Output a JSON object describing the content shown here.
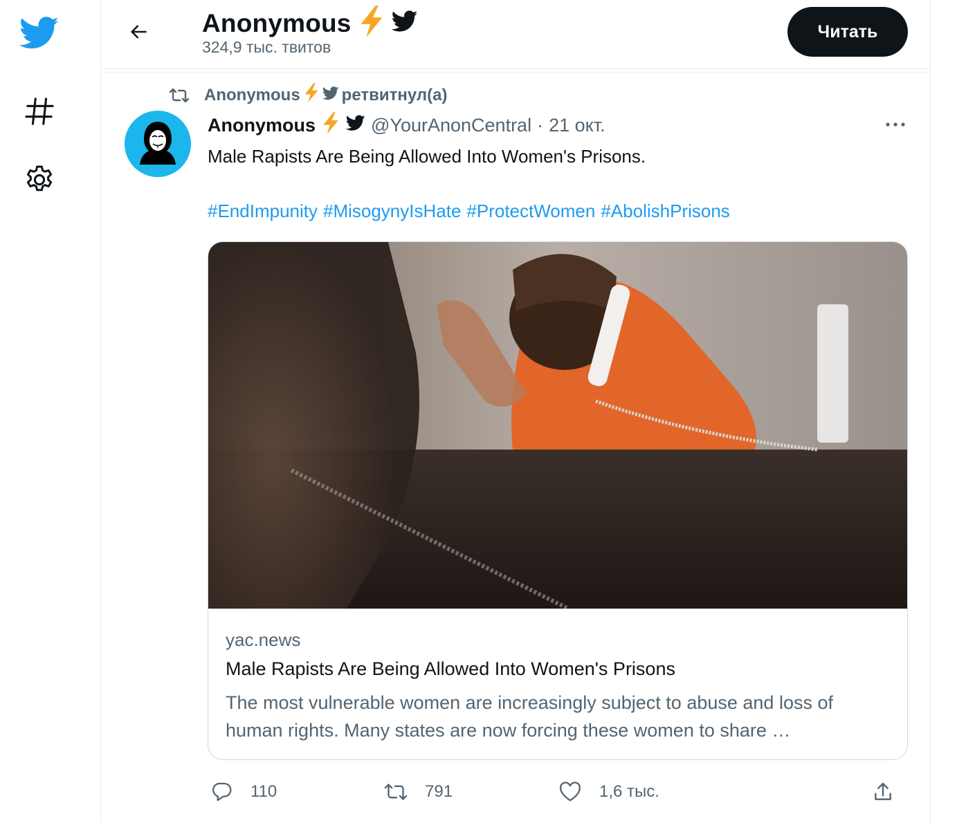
{
  "header": {
    "name": "Anonymous",
    "tweet_count": "324,9 тыс. твитов",
    "follow_label": "Читать"
  },
  "retweet": {
    "by_name": "Anonymous",
    "label": "ретвитнул(а)"
  },
  "tweet": {
    "author_name": "Anonymous",
    "handle": "@YourAnonCentral",
    "dot": "·",
    "date": "21 окт.",
    "text": "Male Rapists Are Being Allowed Into Women's Prisons.",
    "hashtags": [
      "#EndImpunity",
      "#MisogynyIsHate",
      "#ProtectWomen",
      "#AbolishPrisons"
    ],
    "card": {
      "domain": "yac.news",
      "title": "Male Rapists Are Being Allowed Into Women's Prisons",
      "description": "The most vulnerable women are increasingly subject to abuse and loss of human rights. Many states are now forcing these women to share …"
    },
    "actions": {
      "replies": "110",
      "retweets": "791",
      "likes": "1,6 тыс."
    }
  },
  "colors": {
    "brand": "#1d9bf0",
    "text_primary": "#0f1419",
    "text_secondary": "#536471",
    "border": "#cfd9de"
  },
  "icons": [
    "twitter-logo-icon",
    "hashtag-icon",
    "gear-icon",
    "back-arrow-icon",
    "lightning-emoji-icon",
    "twitter-bird-icon",
    "retweet-icon",
    "more-icon",
    "reply-icon",
    "like-icon",
    "share-icon"
  ]
}
